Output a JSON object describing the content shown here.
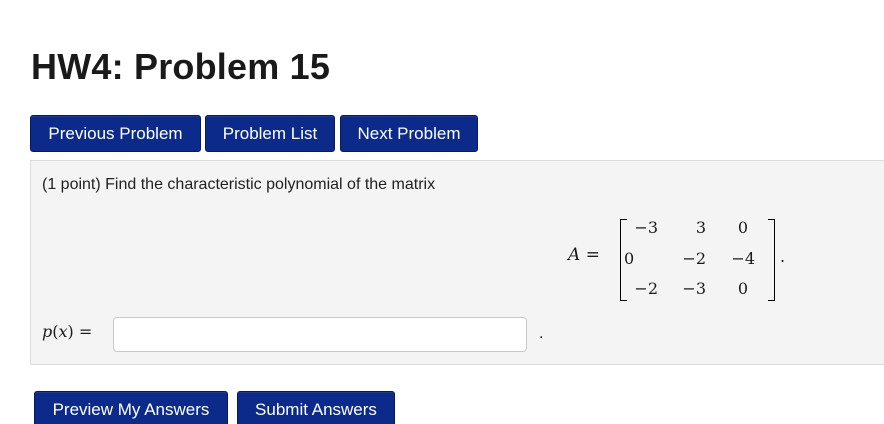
{
  "header": {
    "title": "HW4: Problem 15"
  },
  "nav": {
    "previous_label": "Previous Problem",
    "list_label": "Problem List",
    "next_label": "Next Problem"
  },
  "problem": {
    "points": "(1 point)",
    "statement": "Find the characteristic polynomial of the matrix",
    "matrix_name": "A",
    "equals": "=",
    "matrix": [
      [
        "−3",
        "3",
        "0"
      ],
      [
        "0",
        "−2",
        "−4"
      ],
      [
        "−2",
        "−3",
        "0"
      ]
    ],
    "trailing_period": ".",
    "answer_label_fn": "p",
    "answer_label_var": "x",
    "answer_label_rest": ") =",
    "answer_value": "",
    "answer_trailing": "."
  },
  "actions": {
    "preview_label": "Preview My Answers",
    "submit_label": "Submit Answers"
  },
  "colors": {
    "button_bg": "#0b2a8a",
    "panel_bg": "#f4f4f4"
  }
}
